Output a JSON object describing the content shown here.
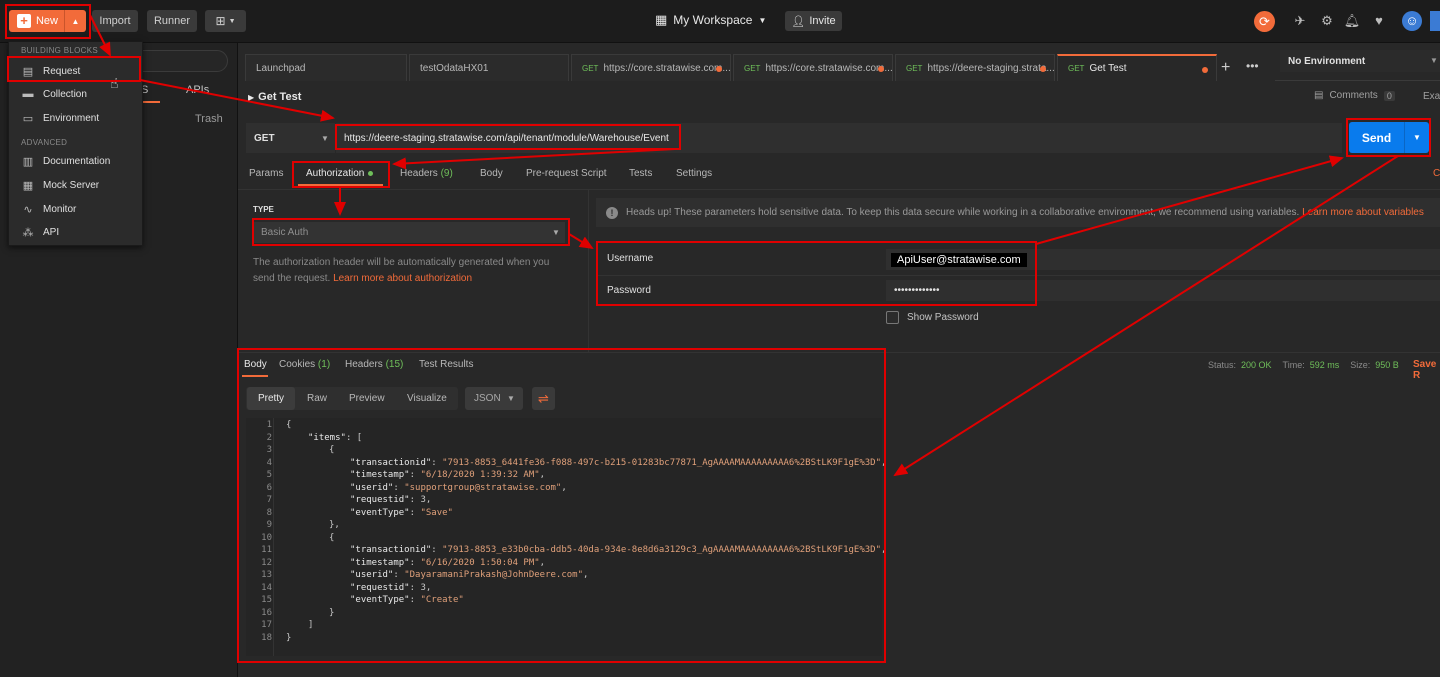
{
  "header": {
    "new_label": "New",
    "import_label": "Import",
    "runner_label": "Runner",
    "workspace_label": "My Workspace",
    "invite_label": "Invite"
  },
  "new_menu": {
    "section_building_blocks": "BUILDING BLOCKS",
    "section_advanced": "ADVANCED",
    "items": {
      "request": "Request",
      "collection": "Collection",
      "environment": "Environment",
      "documentation": "Documentation",
      "mock_server": "Mock Server",
      "monitor": "Monitor",
      "api": "API"
    }
  },
  "sidebar": {
    "tab_s": "S",
    "tab_apis": "APIs",
    "trash_label": "Trash"
  },
  "tabs": [
    {
      "label": "Launchpad",
      "method": ""
    },
    {
      "label": "testOdataHX01",
      "method": ""
    },
    {
      "label": "https://core.stratawise.com...",
      "method": "GET"
    },
    {
      "label": "https://core.stratawise.com...",
      "method": "GET"
    },
    {
      "label": "https://deere-staging.strata...",
      "method": "GET"
    },
    {
      "label": "Get Test",
      "method": "GET"
    }
  ],
  "environment": {
    "label": "No Environment"
  },
  "request": {
    "title": "Get Test",
    "comments_label": "Comments",
    "comments_count": "0",
    "examples_label": "Exa",
    "method": "GET",
    "url": "https://deere-staging.stratawise.com/api/tenant/module/Warehouse/Event",
    "send_label": "Send",
    "tabs": {
      "params": "Params",
      "authorization": "Authorization",
      "headers": "Headers",
      "headers_count": "(9)",
      "body": "Body",
      "pre_request": "Pre-request Script",
      "tests": "Tests",
      "settings": "Settings",
      "right_edge": "C"
    }
  },
  "auth": {
    "type_label": "TYPE",
    "type_value": "Basic Auth",
    "description": "The authorization header will be automatically generated when you send the request. ",
    "description_link": "Learn more about authorization",
    "heads_up": "Heads up! These parameters hold sensitive data. To keep this data secure while working in a collaborative environment, we recommend using variables. ",
    "heads_up_link": "Learn more about variables",
    "username_label": "Username",
    "username_value": "ApiUser@stratawise.com",
    "password_label": "Password",
    "password_value": "•••••••••••••",
    "show_password_label": "Show Password"
  },
  "response": {
    "tabs": {
      "body": "Body",
      "cookies": "Cookies",
      "cookies_count": "(1)",
      "headers": "Headers",
      "headers_count": "(15)",
      "test_results": "Test Results"
    },
    "status_label": "Status:",
    "status_value": "200 OK",
    "time_label": "Time:",
    "time_value": "592 ms",
    "size_label": "Size:",
    "size_value": "950 B",
    "save_label": "Save R",
    "views": {
      "pretty": "Pretty",
      "raw": "Raw",
      "preview": "Preview",
      "visualize": "Visualize"
    },
    "format": "JSON",
    "items_key": "\"items\"",
    "records": [
      {
        "transactionid": "\"7913-8853_6441fe36-f088-497c-b215-01283bc77871_AgAAAAMAAAAAAAAA6%2BStLK9F1gE%3D\"",
        "timestamp": "\"6/18/2020 1:39:32 AM\"",
        "userid": "\"supportgroup@stratawise.com\"",
        "requestid": "3",
        "eventType": "\"Save\""
      },
      {
        "transactionid": "\"7913-8853_e33b0cba-ddb5-40da-934e-8e8d6a3129c3_AgAAAAMAAAAAAAAA6%2BStLK9F1gE%3D\"",
        "timestamp": "\"6/16/2020 1:50:04 PM\"",
        "userid": "\"DayaramaniPrakash@JohnDeere.com\"",
        "requestid": "3",
        "eventType": "\"Create\""
      }
    ]
  },
  "colors": {
    "accent": "#f26b3a",
    "send": "#097bed",
    "annotation": "#e00000",
    "success": "#6fbf5a"
  }
}
